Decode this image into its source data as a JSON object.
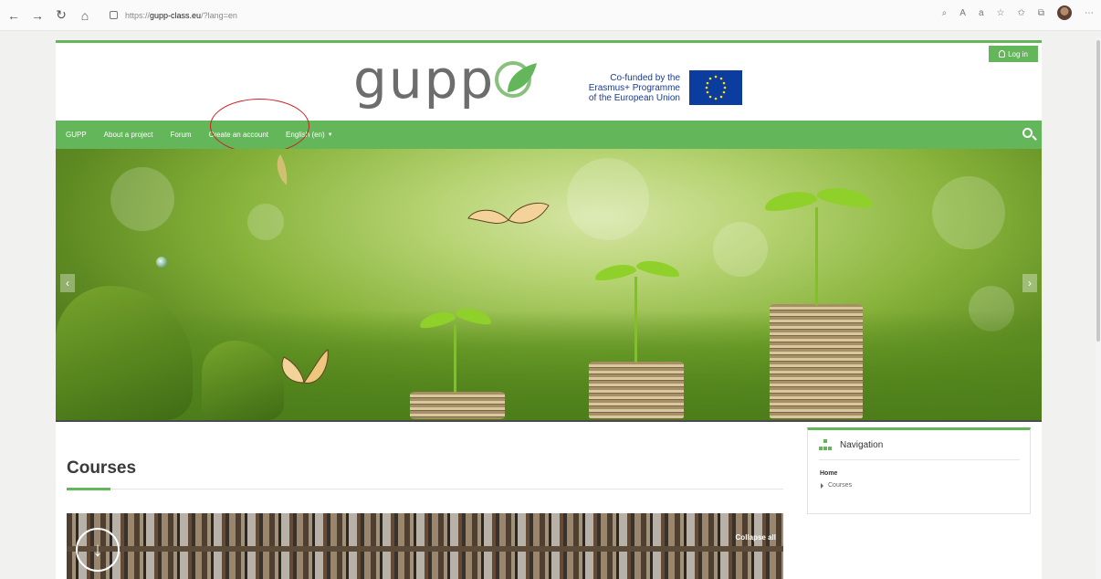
{
  "browser": {
    "url_prefix": "https://",
    "url_host": "gupp-class.eu",
    "url_path": "/?lang=en"
  },
  "header": {
    "login_label": "Log in",
    "logo_text": "gupp",
    "funded_line1": "Co-funded by the",
    "funded_line2": "Erasmus+ Programme",
    "funded_line3": "of the European Union"
  },
  "navbar": {
    "items": [
      {
        "label": "GUPP"
      },
      {
        "label": "About a project"
      },
      {
        "label": "Forum"
      },
      {
        "label": "Create an account"
      },
      {
        "label": "English (en)"
      }
    ]
  },
  "slider": {
    "prev_label": "‹",
    "next_label": "›"
  },
  "courses": {
    "title": "Courses",
    "collapse_all_label": "Collapse all",
    "download_icon": "↓"
  },
  "navigation_block": {
    "title": "Navigation",
    "home_label": "Home",
    "courses_label": "Courses"
  },
  "colors": {
    "brand_green": "#63b65a",
    "highlight_red": "#cc2222",
    "eu_blue": "#0b3d9e"
  }
}
